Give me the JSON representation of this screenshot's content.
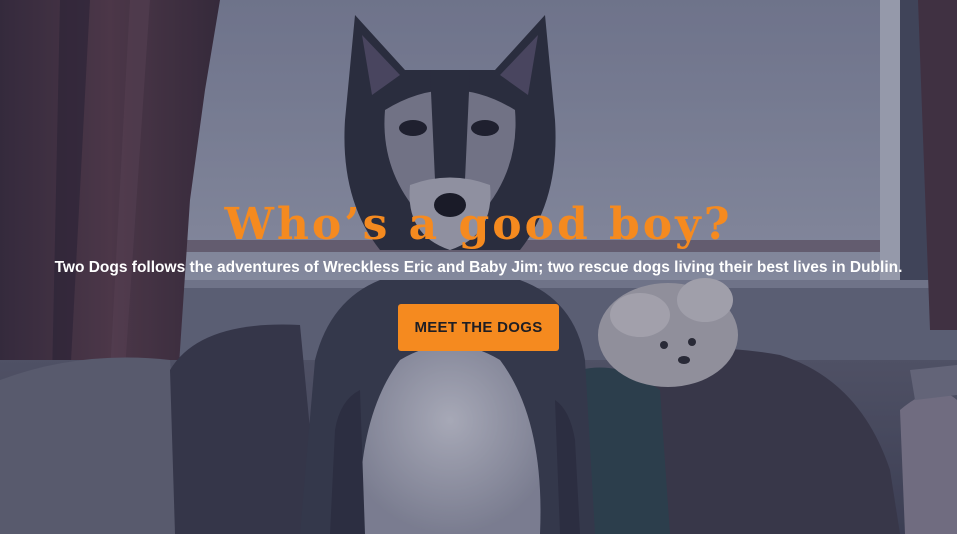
{
  "hero": {
    "title": "Who’s a good boy?",
    "subtitle": "Two Dogs follows the adventures of Wreckless Eric and Baby Jim; two rescue dogs living their best lives in Dublin.",
    "cta_label": "MEET THE DOGS",
    "background_image": "husky-and-small-dog-on-sofa-photo"
  },
  "colors": {
    "accent": "#f58a1f",
    "subtitle_text": "#ffffff",
    "button_text": "#1e1e24"
  }
}
